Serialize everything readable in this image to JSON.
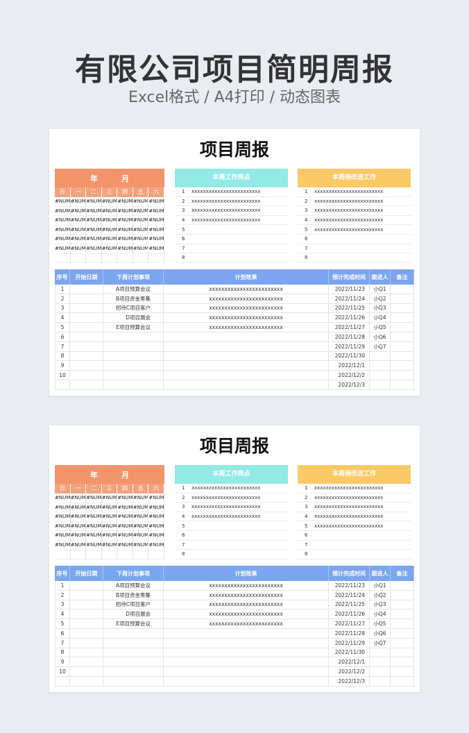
{
  "header": {
    "title": "有限公司项目简明周报",
    "subtitle": "Excel格式 / A4打印 / 动态图表"
  },
  "sheet": {
    "title": "项目周报",
    "calendar": {
      "year_label": "年",
      "month_label": "月",
      "weekdays": [
        "日",
        "一",
        "二",
        "三",
        "四",
        "五",
        "六"
      ],
      "cells": [
        [
          "#NUM!",
          "#NUM!",
          "#NUM!",
          "#NUM!",
          "#NUM!",
          "#NUM!",
          "#NUM!"
        ],
        [
          "#NUM!",
          "#NUM!",
          "#NUM!",
          "#NUM!",
          "#NUM!",
          "#NUM!",
          "#NUM!"
        ],
        [
          "#NUM!",
          "#NUM!",
          "#NUM!",
          "#NUM!",
          "#NUM!",
          "#NUM!",
          "#NUM!"
        ],
        [
          "#NUM!",
          "#NUM!",
          "#NUM!",
          "#NUM!",
          "#NUM!",
          "#NUM!",
          "#NUM!"
        ],
        [
          "#NUM!",
          "#NUM!",
          "#NUM!",
          "#NUM!",
          "#NUM!",
          "#NUM!",
          "#NUM!"
        ],
        [
          "#NUM!",
          "#NUM!",
          "#NUM!",
          "#NUM!",
          "#NUM!",
          "#NUM!",
          "#NUM!"
        ],
        [
          "",
          "",
          "",
          "",
          "",
          "",
          ""
        ]
      ]
    },
    "highlights": {
      "title": "本周工作亮点",
      "color": "#93e9e6",
      "items": [
        {
          "n": "1",
          "text": "xxxxxxxxxxxxxxxxxxxxxxxx"
        },
        {
          "n": "2",
          "text": "xxxxxxxxxxxxxxxxxxxxxxxx"
        },
        {
          "n": "3",
          "text": "xxxxxxxxxxxxxxxxxxxxxxxx"
        },
        {
          "n": "4",
          "text": "xxxxxxxxxxxxxxxxxxxxxxxx"
        },
        {
          "n": "5",
          "text": ""
        },
        {
          "n": "6",
          "text": ""
        },
        {
          "n": "7",
          "text": ""
        },
        {
          "n": "8",
          "text": ""
        }
      ]
    },
    "improvements": {
      "title": "本周待改进工作",
      "color": "#fdc866",
      "items": [
        {
          "n": "1",
          "text": "xxxxxxxxxxxxxxxxxxxxxxxx"
        },
        {
          "n": "2",
          "text": "xxxxxxxxxxxxxxxxxxxxxxxx"
        },
        {
          "n": "3",
          "text": "xxxxxxxxxxxxxxxxxxxxxxxx"
        },
        {
          "n": "4",
          "text": "xxxxxxxxxxxxxxxxxxxxxxxx"
        },
        {
          "n": "5",
          "text": "xxxxxxxxxxxxxxxxxxxxxxxx"
        },
        {
          "n": "6",
          "text": ""
        },
        {
          "n": "7",
          "text": ""
        },
        {
          "n": "8",
          "text": ""
        }
      ]
    },
    "plan": {
      "headers": [
        "序号",
        "开始日期",
        "下周计划事项",
        "计划效果",
        "预计完成时间",
        "跟进人",
        "备注"
      ],
      "rows": [
        [
          "1",
          "",
          "A项目预算会议",
          "xxxxxxxxxxxxxxxxxxxxxxxx",
          "2022/11/23",
          "小Q1",
          ""
        ],
        [
          "2",
          "",
          "B项目资金筹集",
          "xxxxxxxxxxxxxxxxxxxxxxxx",
          "2022/11/24",
          "小Q2",
          ""
        ],
        [
          "3",
          "",
          "招待C项目客户",
          "xxxxxxxxxxxxxxxxxxxxxxxx",
          "2022/11/25",
          "小Q3",
          ""
        ],
        [
          "4",
          "",
          "D项目展会",
          "xxxxxxxxxxxxxxxxxxxxxxxx",
          "2022/11/26",
          "小Q4",
          ""
        ],
        [
          "5",
          "",
          "E项目预算会议",
          "xxxxxxxxxxxxxxxxxxxxxxxx",
          "2022/11/27",
          "小Q5",
          ""
        ],
        [
          "6",
          "",
          "",
          "",
          "2022/11/28",
          "小Q6",
          ""
        ],
        [
          "7",
          "",
          "",
          "",
          "2022/11/29",
          "小Q7",
          ""
        ],
        [
          "8",
          "",
          "",
          "",
          "2022/11/30",
          "",
          ""
        ],
        [
          "9",
          "",
          "",
          "",
          "2022/12/1",
          "",
          ""
        ],
        [
          "10",
          "",
          "",
          "",
          "2022/12/2",
          "",
          ""
        ],
        [
          "",
          "",
          "",
          "",
          "2022/12/3",
          "",
          ""
        ]
      ]
    }
  },
  "colors": {
    "calendar_head": "#f2956b",
    "table_head": "#7ba5ee"
  }
}
